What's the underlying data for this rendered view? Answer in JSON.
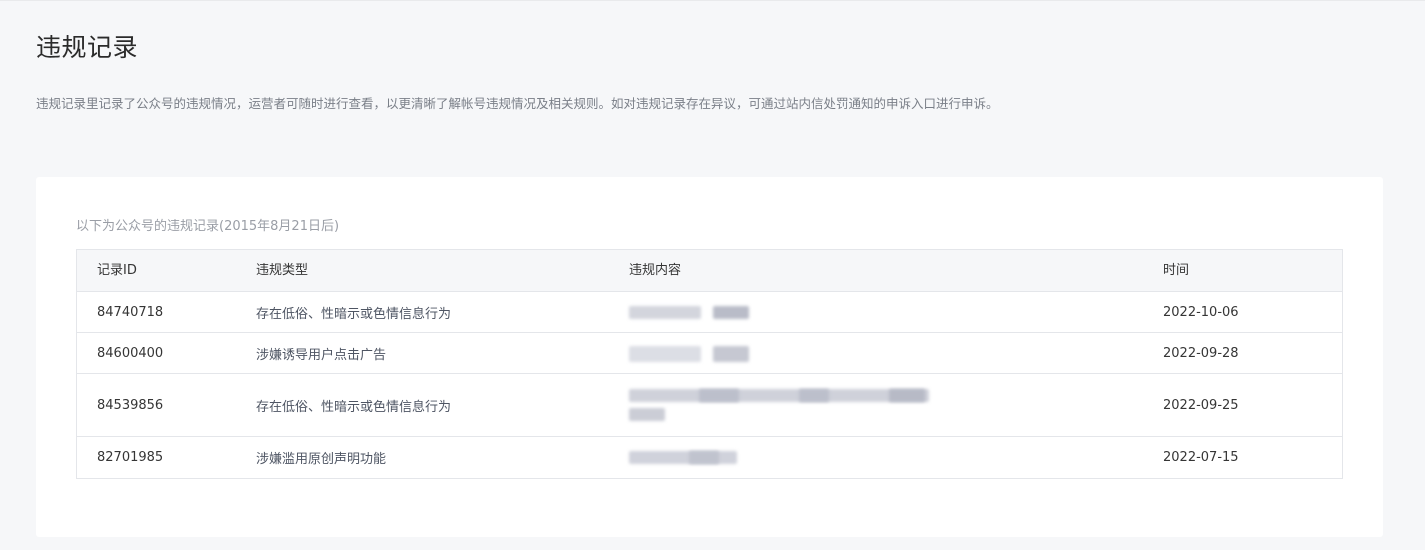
{
  "page": {
    "title": "违规记录",
    "description": "违规记录里记录了公众号的违规情况，运营者可随时进行查看，以更清晰了解帐号违规情况及相关规则。如对违规记录存在异议，可通过站内信处罚通知的申诉入口进行申诉。"
  },
  "card": {
    "caption": "以下为公众号的违规记录(2015年8月21日后)"
  },
  "table": {
    "headers": {
      "id": "记录ID",
      "type": "违规类型",
      "content": "违规内容",
      "time": "时间"
    },
    "rows": [
      {
        "id": "84740718",
        "type": "存在低俗、性暗示或色情信息行为",
        "time": "2022-10-06"
      },
      {
        "id": "84600400",
        "type": "涉嫌诱导用户点击广告",
        "time": "2022-09-28"
      },
      {
        "id": "84539856",
        "type": "存在低俗、性暗示或色情信息行为",
        "time": "2022-09-25"
      },
      {
        "id": "82701985",
        "type": "涉嫌滥用原创声明功能",
        "time": "2022-07-15"
      }
    ]
  },
  "colors": {
    "page_bg": "#f6f7f9",
    "card_bg": "#ffffff",
    "border": "#e4e6ea",
    "header_bg": "#f6f7f9",
    "redaction": "#c9cbd4"
  }
}
